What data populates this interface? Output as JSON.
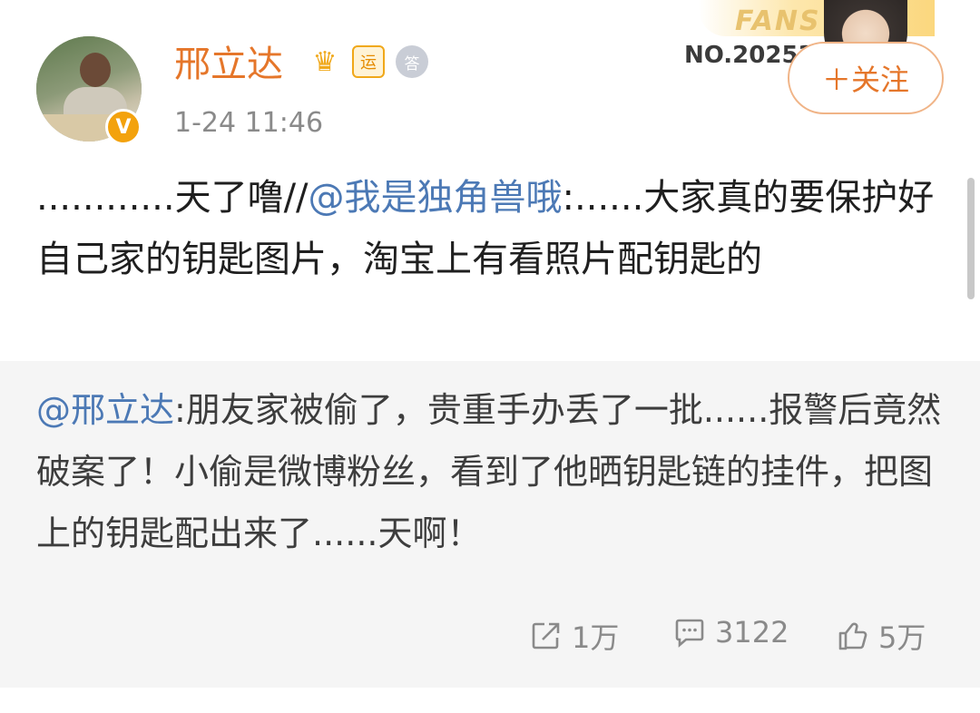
{
  "author": {
    "name": "邢立达",
    "verified_badge": "V",
    "badge_yun": "运",
    "badge_da": "答",
    "time": "1-24 11:46"
  },
  "fans_card": {
    "word": "FANS",
    "number": "NO.20253"
  },
  "follow_button": {
    "label": "＋关注"
  },
  "post": {
    "prefix": "............天了噜//",
    "mention": "@我是独角兽哦",
    "body": ":......大家真的要保护好自己家的钥匙图片，淘宝上有看照片配钥匙的"
  },
  "retweet": {
    "mention": "@邢立达",
    "body": ":朋友家被偷了，贵重手办丢了一批......报警后竟然破案了！小偷是微博粉丝，看到了他晒钥匙链的挂件，把图上的钥匙配出来了......天啊！"
  },
  "actions": {
    "repost_icon": "share-icon",
    "repost_count": "1万",
    "comment_icon": "comment-icon",
    "comment_count": "3122",
    "like_icon": "thumbs-up-icon",
    "like_count": "5万"
  },
  "colors": {
    "accent": "#e5762a",
    "mention": "#4c79b5",
    "retweet_bg": "#f5f5f5",
    "muted": "#8a8a8a"
  }
}
